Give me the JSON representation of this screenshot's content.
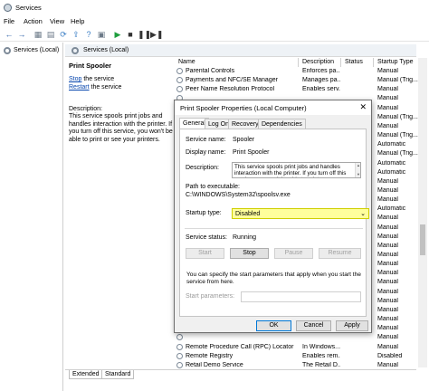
{
  "window": {
    "title": "Services"
  },
  "menu": [
    "File",
    "Action",
    "View",
    "Help"
  ],
  "tree": {
    "root_label": "Services (Local)"
  },
  "services_header": {
    "label": "Services (Local)"
  },
  "left_pane": {
    "service_name": "Print Spooler",
    "stop_link": "Stop",
    "stop_rest": " the service",
    "restart_link": "Restart",
    "restart_rest": " the service",
    "description_label": "Description:",
    "description": "This service spools print jobs and handles interaction with the printer. If you turn off this service, you won't be able to print or see your printers."
  },
  "list": {
    "columns": [
      "Name",
      "Description",
      "Status",
      "Startup Type"
    ],
    "rows": [
      {
        "name": "Parental Controls",
        "description": "Enforces pa...",
        "status": "",
        "startup": "Manual"
      },
      {
        "name": "Payments and NFC/SE Manager",
        "description": "Manages pa...",
        "status": "",
        "startup": "Manual (Trig..."
      },
      {
        "name": "Peer Name Resolution Protocol",
        "description": "Enables serv...",
        "status": "",
        "startup": "Manual"
      },
      {
        "name": "",
        "description": "",
        "status": "",
        "startup": "Manual"
      },
      {
        "name": "",
        "description": "",
        "status": "",
        "startup": "Manual"
      },
      {
        "name": "",
        "description": "",
        "status": "",
        "startup": "Manual (Trig..."
      },
      {
        "name": "",
        "description": "",
        "status": "",
        "startup": "Manual"
      },
      {
        "name": "",
        "description": "",
        "status": "",
        "startup": "Manual (Trig..."
      },
      {
        "name": "",
        "description": "",
        "status": "",
        "startup": "Automatic"
      },
      {
        "name": "",
        "description": "",
        "status": "",
        "startup": "Manual (Trig..."
      },
      {
        "name": "",
        "description": "",
        "status": "",
        "startup": "Automatic"
      },
      {
        "name": "",
        "description": "",
        "status": "",
        "startup": "Automatic"
      },
      {
        "name": "",
        "description": "",
        "status": "",
        "startup": "Manual"
      },
      {
        "name": "",
        "description": "",
        "status": "",
        "startup": "Manual"
      },
      {
        "name": "",
        "description": "",
        "status": "",
        "startup": "Manual"
      },
      {
        "name": "",
        "description": "",
        "status": "",
        "startup": "Automatic"
      },
      {
        "name": "",
        "description": "",
        "status": "",
        "startup": "Manual"
      },
      {
        "name": "",
        "description": "",
        "status": "",
        "startup": "Manual"
      },
      {
        "name": "",
        "description": "",
        "status": "",
        "startup": "Manual"
      },
      {
        "name": "",
        "description": "",
        "status": "",
        "startup": "Manual"
      },
      {
        "name": "",
        "description": "",
        "status": "",
        "startup": "Manual"
      },
      {
        "name": "",
        "description": "",
        "status": "",
        "startup": "Manual"
      },
      {
        "name": "",
        "description": "",
        "status": "",
        "startup": "Manual"
      },
      {
        "name": "",
        "description": "",
        "status": "",
        "startup": "Manual"
      },
      {
        "name": "",
        "description": "",
        "status": "",
        "startup": "Manual"
      },
      {
        "name": "",
        "description": "",
        "status": "",
        "startup": "Manual"
      },
      {
        "name": "",
        "description": "",
        "status": "",
        "startup": "Manual"
      },
      {
        "name": "",
        "description": "",
        "status": "",
        "startup": "Manual"
      },
      {
        "name": "",
        "description": "",
        "status": "",
        "startup": "Manual"
      },
      {
        "name": "",
        "description": "",
        "status": "",
        "startup": "Manual"
      },
      {
        "name": "Remote Procedure Call (RPC) Locator",
        "description": "In Windows...",
        "status": "",
        "startup": "Manual"
      },
      {
        "name": "Remote Registry",
        "description": "Enables rem...",
        "status": "",
        "startup": "Disabled"
      },
      {
        "name": "Retail Demo Service",
        "description": "The Retail D...",
        "status": "",
        "startup": "Manual"
      }
    ]
  },
  "bottom_tabs": [
    "Extended",
    "Standard"
  ],
  "dialog": {
    "title": "Print Spooler Properties (Local Computer)",
    "close": "✕",
    "tabs": [
      "General",
      "Log On",
      "Recovery",
      "Dependencies"
    ],
    "service_name_label": "Service name:",
    "service_name": "Spooler",
    "display_name_label": "Display name:",
    "display_name": "Print Spooler",
    "description_label": "Description:",
    "description": "This service spools print jobs and handles interaction with the printer. If you turn off this service, you won't be able to print or see your printers.",
    "path_label": "Path to executable:",
    "path": "C:\\WINDOWS\\System32\\spoolsv.exe",
    "startup_type_label": "Startup type:",
    "startup_type": "Disabled",
    "status_label": "Service status:",
    "status": "Running",
    "start": "Start",
    "stop": "Stop",
    "pause": "Pause",
    "resume": "Resume",
    "note": "You can specify the start parameters that apply when you start the service from here.",
    "params_label": "Start parameters:",
    "ok": "OK",
    "cancel": "Cancel",
    "apply": "Apply"
  },
  "colors": {
    "highlight": "#ffff9c",
    "link": "#0645ad",
    "accent": "#0078d7"
  }
}
